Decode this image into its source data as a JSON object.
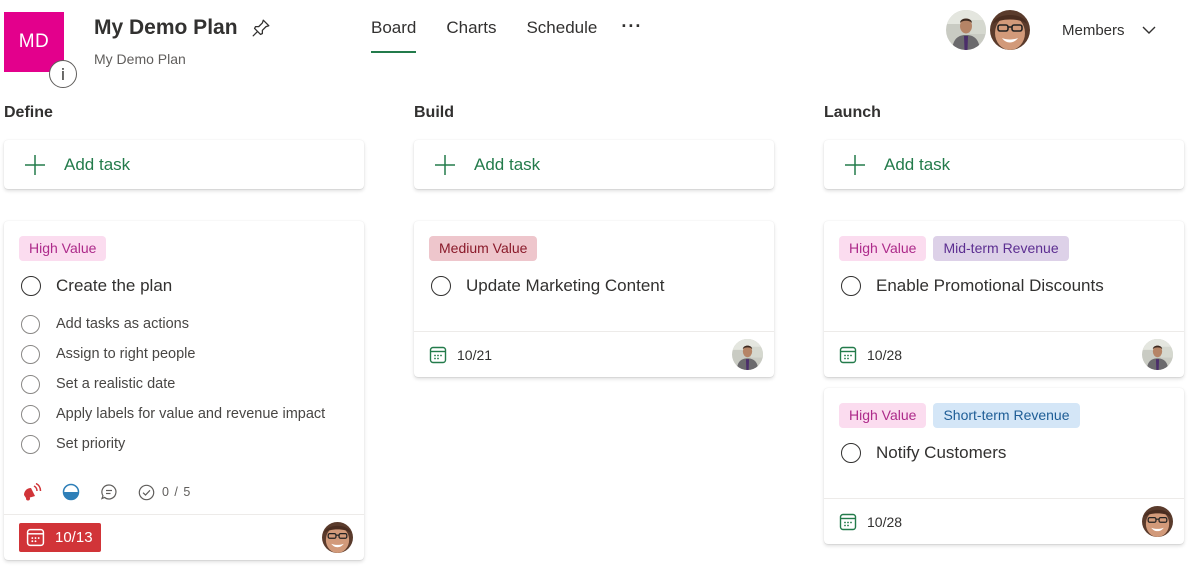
{
  "header": {
    "plan_initials": "MD",
    "plan_color": "#e3008c",
    "info_badge": "i",
    "title": "My Demo Plan",
    "subtitle": "My Demo Plan",
    "pin_icon": "pin-icon",
    "tabs": [
      {
        "label": "Board",
        "active": true
      },
      {
        "label": "Charts",
        "active": false
      },
      {
        "label": "Schedule",
        "active": false
      }
    ],
    "more_label": "···",
    "members_label": "Members",
    "member_avatars": [
      "man-avatar",
      "woman-avatar"
    ]
  },
  "accent_color": "#237b4b",
  "columns": [
    {
      "title": "Define",
      "add_task_label": "Add task",
      "cards": [
        {
          "labels": [
            {
              "text": "High Value",
              "color": "pink"
            }
          ],
          "title": "Create the plan",
          "checklist": [
            "Add tasks as actions",
            "Assign to right people",
            "Set a realistic date",
            "Apply labels for value and revenue impact",
            "Set priority"
          ],
          "indicators": {
            "priority": "urgent",
            "progress": "in progress",
            "comments": true,
            "checklist_count": "0 / 5"
          },
          "due": "10/13",
          "due_overdue": true,
          "assignee": "woman-avatar"
        }
      ]
    },
    {
      "title": "Build",
      "add_task_label": "Add task",
      "cards": [
        {
          "labels": [
            {
              "text": "Medium Value",
              "color": "medium"
            }
          ],
          "title": "Update Marketing Content",
          "due": "10/21",
          "due_overdue": false,
          "assignee": "man-avatar"
        }
      ]
    },
    {
      "title": "Launch",
      "add_task_label": "Add task",
      "cards": [
        {
          "labels": [
            {
              "text": "High Value",
              "color": "pink"
            },
            {
              "text": "Mid-term Revenue",
              "color": "purple"
            }
          ],
          "title": "Enable Promotional Discounts",
          "due": "10/28",
          "due_overdue": false,
          "assignee": "man-avatar"
        },
        {
          "labels": [
            {
              "text": "High Value",
              "color": "pink"
            },
            {
              "text": "Short-term Revenue",
              "color": "blue"
            }
          ],
          "title": "Notify Customers",
          "due": "10/28",
          "due_overdue": false,
          "assignee": "woman-avatar"
        }
      ]
    }
  ]
}
